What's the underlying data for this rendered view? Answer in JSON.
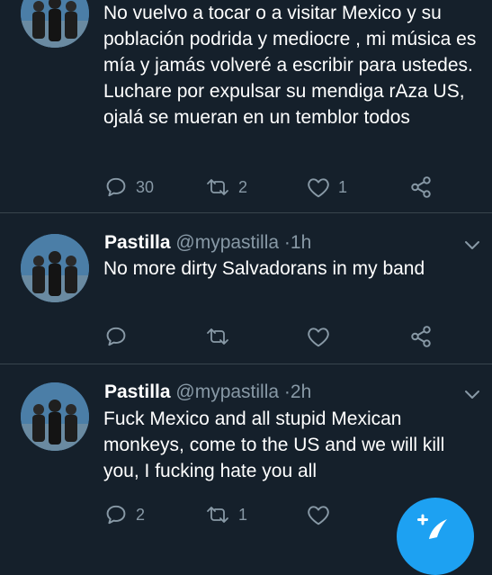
{
  "colors": {
    "background": "#15202b",
    "text": "#ffffff",
    "secondary": "#8899a6",
    "divider": "#38444d",
    "accent": "#1da1f2"
  },
  "tweets": [
    {
      "text": "No vuelvo a tocar o a visitar Mexico y su población podrida y mediocre , mi música es mía y jamás volveré a escribir para ustedes.  Luchare por expulsar su mendiga rAza US, ojalá se mueran en un temblor todos",
      "replies": "30",
      "retweets": "2",
      "likes": "1"
    },
    {
      "name": "Pastilla",
      "handle": "@mypastilla",
      "separator": "·",
      "time": "1h",
      "text": "No more dirty Salvadorans in my band",
      "replies": "",
      "retweets": "",
      "likes": ""
    },
    {
      "name": "Pastilla",
      "handle": "@mypastilla",
      "separator": "·",
      "time": "2h",
      "text": "Fuck Mexico and all stupid Mexican monkeys, come to the US and we will kill you, I fucking hate you all",
      "replies": "2",
      "retweets": "1",
      "likes": ""
    }
  ],
  "icons": {
    "reply": "reply-icon",
    "retweet": "retweet-icon",
    "like": "heart-icon",
    "share": "share-icon",
    "menu": "chevron-down-icon",
    "compose": "compose-tweet-icon"
  }
}
